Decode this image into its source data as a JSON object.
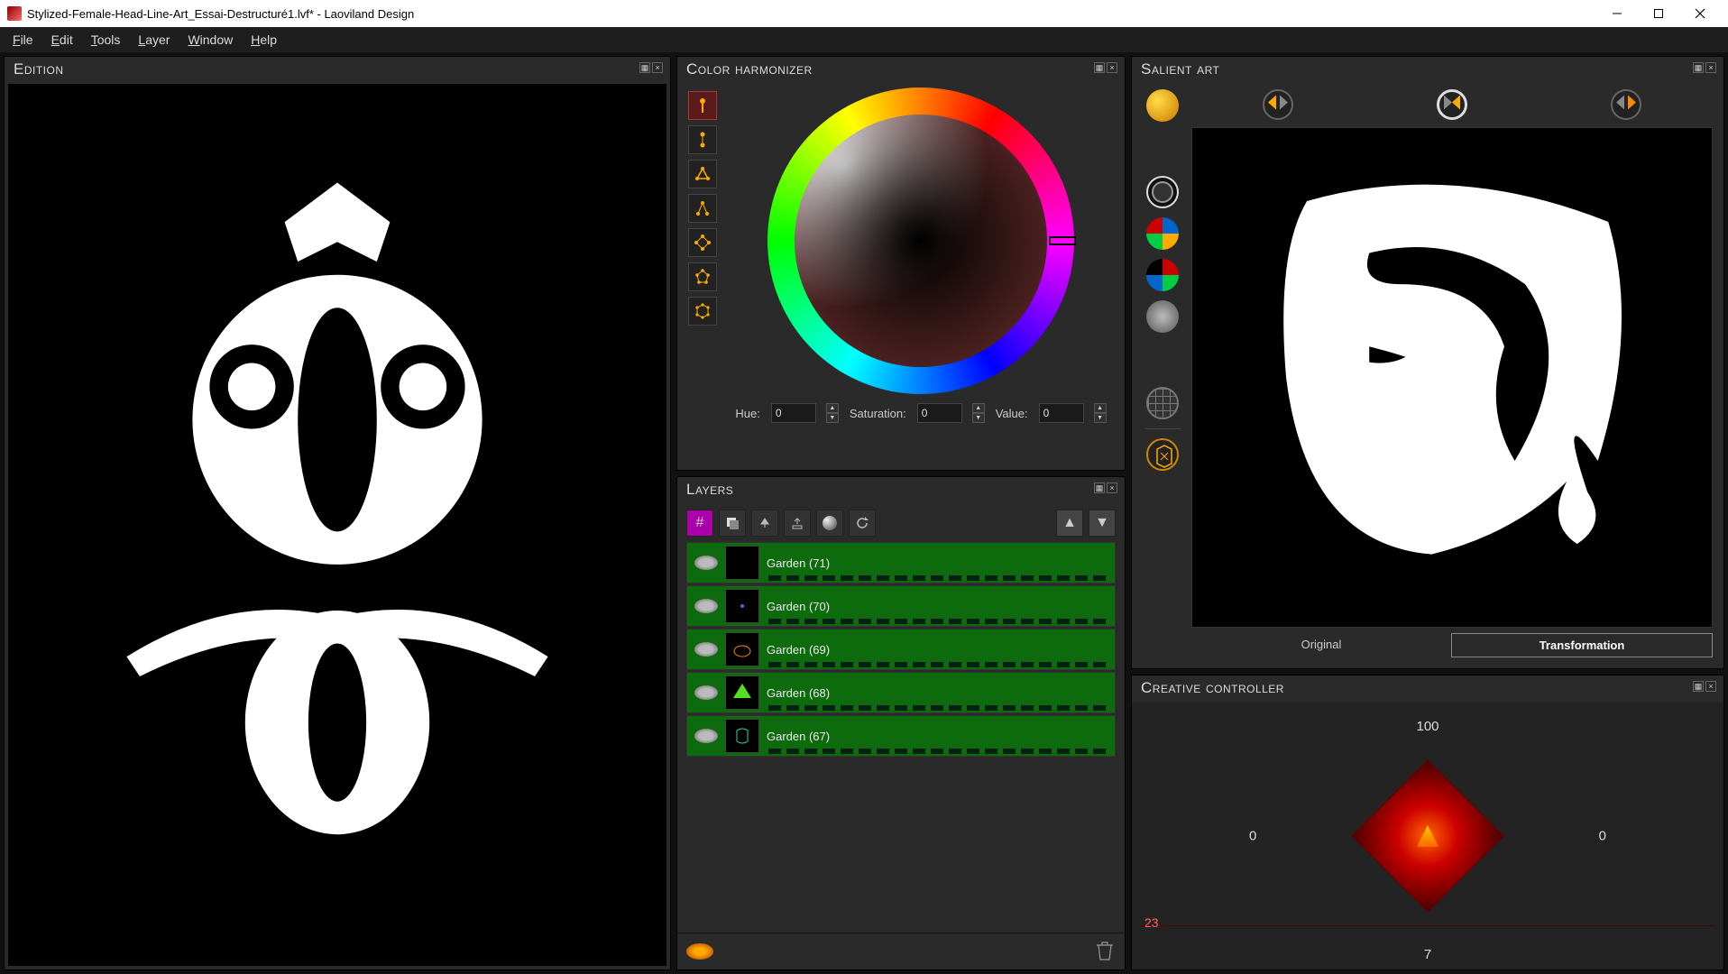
{
  "window": {
    "title": "Stylized-Female-Head-Line-Art_Essai-Destructuré1.lvf* - Laoviland Design"
  },
  "menu": {
    "file": "File",
    "edit": "Edit",
    "tools": "Tools",
    "layer": "Layer",
    "window": "Window",
    "help": "Help"
  },
  "panels": {
    "edition": "Edition",
    "harmonizer": "Color harmonizer",
    "layers": "Layers",
    "salient": "Salient art",
    "creative": "Creative controller"
  },
  "harmonizer": {
    "hue_label": "Hue:",
    "hue": "0",
    "sat_label": "Saturation:",
    "sat": "0",
    "val_label": "Value:",
    "val": "0"
  },
  "layers": {
    "items": [
      {
        "name": "Garden (71)"
      },
      {
        "name": "Garden (70)"
      },
      {
        "name": "Garden (69)"
      },
      {
        "name": "Garden (68)"
      },
      {
        "name": "Garden (67)"
      }
    ]
  },
  "salient": {
    "tabs": {
      "original": "Original",
      "transformation": "Transformation"
    }
  },
  "creative": {
    "top": "100",
    "left": "0",
    "right": "0",
    "bottom": "7",
    "marker": "23"
  }
}
